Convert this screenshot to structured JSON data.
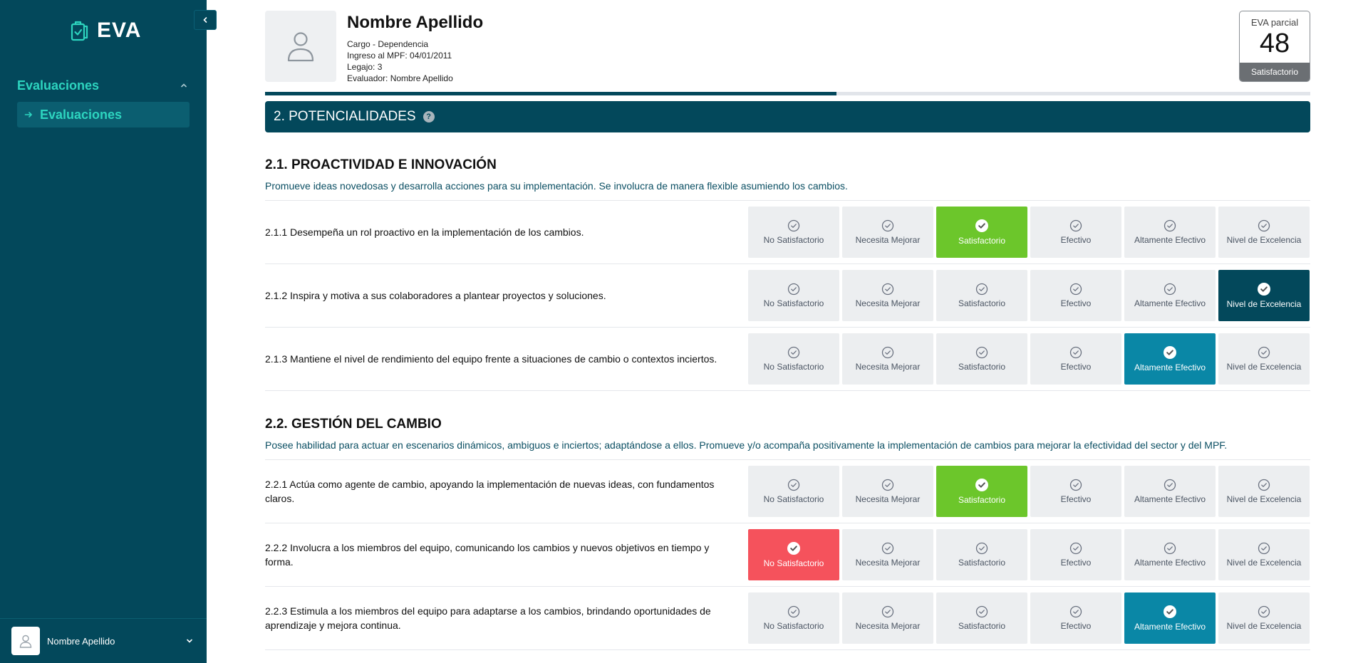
{
  "sidebar": {
    "brand": "EVA",
    "nav_group": "Evaluaciones",
    "nav_item": "Evaluaciones",
    "user_name": "Nombre Apellido"
  },
  "header": {
    "name": "Nombre Apellido",
    "cargo": "Cargo - Dependencia",
    "ingreso": "Ingreso al MPF: 04/01/2011",
    "legajo": "Legajo: 3",
    "evaluador": "Evaluador: Nombre Apellido"
  },
  "eva": {
    "label": "EVA parcial",
    "score": "48",
    "status": "Satisfactorio"
  },
  "progress": {
    "fraction": 0.547
  },
  "section": {
    "title": "2. POTENCIALIDADES",
    "help": "?"
  },
  "levels": [
    "No Satisfactorio",
    "Necesita Mejorar",
    "Satisfactorio",
    "Efectivo",
    "Altamente Efectivo",
    "Nivel de Excelencia"
  ],
  "level_colors": {
    "No Satisfactorio": "#f5525c",
    "Satisfactorio": "#6cc62b",
    "Altamente Efectivo": "#0a87a6",
    "Nivel de Excelencia": "#03485b"
  },
  "subsections": [
    {
      "title": "2.1. PROACTIVIDAD E INNOVACIÓN",
      "description": "Promueve ideas novedosas y desarrolla acciones para su implementación. Se involucra de manera flexible asumiendo los cambios.",
      "items": [
        {
          "text": "2.1.1 Desempeña un rol proactivo en la implementación de los cambios.",
          "selected": 2
        },
        {
          "text": "2.1.2 Inspira y motiva a sus colaboradores a plantear proyectos y soluciones.",
          "selected": 5
        },
        {
          "text": "2.1.3 Mantiene el nivel de rendimiento del equipo frente a situaciones de cambio o contextos inciertos.",
          "selected": 4
        }
      ]
    },
    {
      "title": "2.2. GESTIÓN DEL CAMBIO",
      "description": "Posee habilidad para actuar en escenarios dinámicos, ambiguos e inciertos; adaptándose a ellos. Promueve y/o acompaña positivamente la implementación de cambios para mejorar la efectividad del sector y del MPF.",
      "items": [
        {
          "text": "2.2.1 Actúa como agente de cambio, apoyando la implementación de nuevas ideas, con fundamentos claros.",
          "selected": 2
        },
        {
          "text": "2.2.2 Involucra a los miembros del equipo, comunicando los cambios y nuevos objetivos en tiempo y forma.",
          "selected": 0
        },
        {
          "text": "2.2.3 Estimula a los miembros del equipo para adaptarse a los cambios, brindando oportunidades de aprendizaje y mejora continua.",
          "selected": 4
        }
      ]
    }
  ],
  "icons": {
    "brand": "clipboard-check-icon",
    "collapse": "chevron-left-icon",
    "group": "chevron-up-icon",
    "nav": "arrow-right-icon",
    "user": "user-icon",
    "user_menu": "chevron-down-icon",
    "option": "check-circle-icon"
  }
}
